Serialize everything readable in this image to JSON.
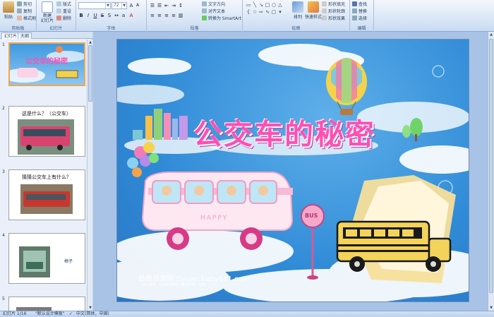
{
  "ribbon": {
    "clipboard": {
      "paste": "粘贴",
      "cut": "剪切",
      "copy": "复制",
      "format_painter": "格式刷",
      "label": "剪贴板"
    },
    "slides": {
      "new_slide": "新建\n幻灯片",
      "layout": "版式",
      "reset": "重设",
      "delete": "删除",
      "label": "幻灯片"
    },
    "font": {
      "font_name": "",
      "font_size": "72",
      "label": "字体"
    },
    "paragraph": {
      "text_direction": "文字方向",
      "align_text": "对齐文本",
      "smartart": "转换为 SmartArt",
      "label": "段落"
    },
    "drawing": {
      "arrange": "排列",
      "quick_styles": "快速样式",
      "shape_fill": "形状填充",
      "shape_outline": "形状轮廓",
      "shape_effects": "形状效果",
      "label": "绘图"
    },
    "editing": {
      "find": "查找",
      "replace": "替换",
      "select": "选择",
      "label": "编辑"
    }
  },
  "left_pane": {
    "tabs": [
      "幻灯片",
      "大纲"
    ],
    "slides": [
      {
        "num": "1",
        "title": ""
      },
      {
        "num": "2",
        "title": "这是什么？（公交车）"
      },
      {
        "num": "3",
        "title": "猜猜公交车上有什么？"
      },
      {
        "num": "4",
        "title": ""
      },
      {
        "num": "5",
        "title": ""
      }
    ],
    "slide4_caption": "椅子"
  },
  "slide": {
    "title": "公交车的秘密",
    "bus_text": "HAPPY",
    "sign_text": "BUS",
    "site": "幼教资源网 ziyuan.baby611.com",
    "subsite": "PPT课件 · FLASH课件 · 教育故事 · 试卷"
  },
  "status": {
    "slide_info": "幻灯片 1/16",
    "theme": "\"默认设计模板\"",
    "language": "中文(简体，中国)"
  },
  "colors": {
    "accent": "#ff4fb4",
    "sky": "#2f8ad6",
    "ribbon": "#dbe7f6"
  }
}
